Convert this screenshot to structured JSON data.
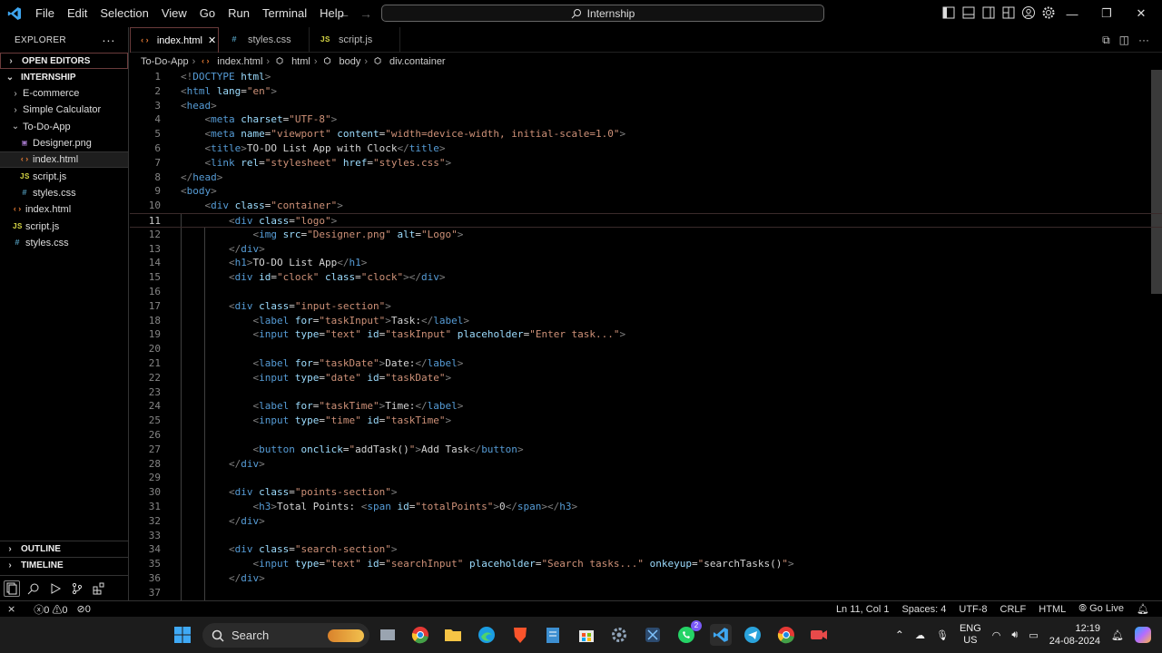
{
  "menu": [
    "File",
    "Edit",
    "Selection",
    "View",
    "Go",
    "Run",
    "Terminal",
    "Help"
  ],
  "command_center": "Internship",
  "explorer": {
    "title": "EXPLORER",
    "open_editors": "OPEN EDITORS",
    "folder": "INTERNSHIP",
    "items": [
      {
        "label": "E-commerce",
        "kind": "folder"
      },
      {
        "label": "Simple Calculator",
        "kind": "folder"
      },
      {
        "label": "To-Do-App",
        "kind": "folder-open"
      },
      {
        "label": "Designer.png",
        "kind": "png"
      },
      {
        "label": "index.html",
        "kind": "html"
      },
      {
        "label": "script.js",
        "kind": "js"
      },
      {
        "label": "styles.css",
        "kind": "css"
      },
      {
        "label": "index.html",
        "kind": "html"
      },
      {
        "label": "script.js",
        "kind": "js"
      },
      {
        "label": "styles.css",
        "kind": "css"
      }
    ],
    "outline": "OUTLINE",
    "timeline": "TIMELINE"
  },
  "tabs": [
    {
      "label": "index.html",
      "kind": "html",
      "active": true
    },
    {
      "label": "styles.css",
      "kind": "css"
    },
    {
      "label": "script.js",
      "kind": "js"
    }
  ],
  "breadcrumb": [
    "To-Do-App",
    "index.html",
    "html",
    "body",
    "div.container"
  ],
  "current_line": 11,
  "code_lines": [
    [
      [
        "g",
        "<!"
      ],
      [
        "t",
        "DOCTYPE"
      ],
      [
        "a",
        " html"
      ],
      [
        "g",
        ">"
      ]
    ],
    [
      [
        "g",
        "<"
      ],
      [
        "t",
        "html"
      ],
      [
        "a",
        " lang"
      ],
      [
        "x",
        "="
      ],
      [
        "s",
        "\"en\""
      ],
      [
        "g",
        ">"
      ]
    ],
    [
      [
        "g",
        "<"
      ],
      [
        "t",
        "head"
      ],
      [
        "g",
        ">"
      ]
    ],
    [
      [
        "x",
        "    "
      ],
      [
        "g",
        "<"
      ],
      [
        "t",
        "meta"
      ],
      [
        "a",
        " charset"
      ],
      [
        "x",
        "="
      ],
      [
        "s",
        "\"UTF-8\""
      ],
      [
        "g",
        ">"
      ]
    ],
    [
      [
        "x",
        "    "
      ],
      [
        "g",
        "<"
      ],
      [
        "t",
        "meta"
      ],
      [
        "a",
        " name"
      ],
      [
        "x",
        "="
      ],
      [
        "s",
        "\"viewport\""
      ],
      [
        "a",
        " content"
      ],
      [
        "x",
        "="
      ],
      [
        "s",
        "\"width=device-width, initial-scale=1.0\""
      ],
      [
        "g",
        ">"
      ]
    ],
    [
      [
        "x",
        "    "
      ],
      [
        "g",
        "<"
      ],
      [
        "t",
        "title"
      ],
      [
        "g",
        ">"
      ],
      [
        "x",
        "TO-DO List App with Clock"
      ],
      [
        "g",
        "</"
      ],
      [
        "t",
        "title"
      ],
      [
        "g",
        ">"
      ]
    ],
    [
      [
        "x",
        "    "
      ],
      [
        "g",
        "<"
      ],
      [
        "t",
        "link"
      ],
      [
        "a",
        " rel"
      ],
      [
        "x",
        "="
      ],
      [
        "s",
        "\"stylesheet\""
      ],
      [
        "a",
        " href"
      ],
      [
        "x",
        "="
      ],
      [
        "s",
        "\"styles.css\""
      ],
      [
        "g",
        ">"
      ]
    ],
    [
      [
        "g",
        "</"
      ],
      [
        "t",
        "head"
      ],
      [
        "g",
        ">"
      ]
    ],
    [
      [
        "g",
        "<"
      ],
      [
        "t",
        "body"
      ],
      [
        "g",
        ">"
      ]
    ],
    [
      [
        "x",
        "    "
      ],
      [
        "g",
        "<"
      ],
      [
        "t",
        "div"
      ],
      [
        "a",
        " class"
      ],
      [
        "x",
        "="
      ],
      [
        "s",
        "\"container\""
      ],
      [
        "g",
        ">"
      ]
    ],
    [
      [
        "x",
        "        "
      ],
      [
        "g",
        "<"
      ],
      [
        "t",
        "div"
      ],
      [
        "a",
        " class"
      ],
      [
        "x",
        "="
      ],
      [
        "s",
        "\"logo\""
      ],
      [
        "g",
        ">"
      ]
    ],
    [
      [
        "x",
        "            "
      ],
      [
        "g",
        "<"
      ],
      [
        "t",
        "img"
      ],
      [
        "a",
        " src"
      ],
      [
        "x",
        "="
      ],
      [
        "s",
        "\"Designer.png\""
      ],
      [
        "a",
        " alt"
      ],
      [
        "x",
        "="
      ],
      [
        "s",
        "\"Logo\""
      ],
      [
        "g",
        ">"
      ]
    ],
    [
      [
        "x",
        "        "
      ],
      [
        "g",
        "</"
      ],
      [
        "t",
        "div"
      ],
      [
        "g",
        ">"
      ]
    ],
    [
      [
        "x",
        "        "
      ],
      [
        "g",
        "<"
      ],
      [
        "t",
        "h1"
      ],
      [
        "g",
        ">"
      ],
      [
        "x",
        "TO-DO List App"
      ],
      [
        "g",
        "</"
      ],
      [
        "t",
        "h1"
      ],
      [
        "g",
        ">"
      ]
    ],
    [
      [
        "x",
        "        "
      ],
      [
        "g",
        "<"
      ],
      [
        "t",
        "div"
      ],
      [
        "a",
        " id"
      ],
      [
        "x",
        "="
      ],
      [
        "s",
        "\"clock\""
      ],
      [
        "a",
        " class"
      ],
      [
        "x",
        "="
      ],
      [
        "s",
        "\"clock\""
      ],
      [
        "g",
        "></"
      ],
      [
        "t",
        "div"
      ],
      [
        "g",
        ">"
      ]
    ],
    [],
    [
      [
        "x",
        "        "
      ],
      [
        "g",
        "<"
      ],
      [
        "t",
        "div"
      ],
      [
        "a",
        " class"
      ],
      [
        "x",
        "="
      ],
      [
        "s",
        "\"input-section\""
      ],
      [
        "g",
        ">"
      ]
    ],
    [
      [
        "x",
        "            "
      ],
      [
        "g",
        "<"
      ],
      [
        "t",
        "label"
      ],
      [
        "a",
        " for"
      ],
      [
        "x",
        "="
      ],
      [
        "s",
        "\"taskInput\""
      ],
      [
        "g",
        ">"
      ],
      [
        "x",
        "Task:"
      ],
      [
        "g",
        "</"
      ],
      [
        "t",
        "label"
      ],
      [
        "g",
        ">"
      ]
    ],
    [
      [
        "x",
        "            "
      ],
      [
        "g",
        "<"
      ],
      [
        "t",
        "input"
      ],
      [
        "a",
        " type"
      ],
      [
        "x",
        "="
      ],
      [
        "s",
        "\"text\""
      ],
      [
        "a",
        " id"
      ],
      [
        "x",
        "="
      ],
      [
        "s",
        "\"taskInput\""
      ],
      [
        "a",
        " placeholder"
      ],
      [
        "x",
        "="
      ],
      [
        "s",
        "\"Enter task...\""
      ],
      [
        "g",
        ">"
      ]
    ],
    [],
    [
      [
        "x",
        "            "
      ],
      [
        "g",
        "<"
      ],
      [
        "t",
        "label"
      ],
      [
        "a",
        " for"
      ],
      [
        "x",
        "="
      ],
      [
        "s",
        "\"taskDate\""
      ],
      [
        "g",
        ">"
      ],
      [
        "x",
        "Date:"
      ],
      [
        "g",
        "</"
      ],
      [
        "t",
        "label"
      ],
      [
        "g",
        ">"
      ]
    ],
    [
      [
        "x",
        "            "
      ],
      [
        "g",
        "<"
      ],
      [
        "t",
        "input"
      ],
      [
        "a",
        " type"
      ],
      [
        "x",
        "="
      ],
      [
        "s",
        "\"date\""
      ],
      [
        "a",
        " id"
      ],
      [
        "x",
        "="
      ],
      [
        "s",
        "\"taskDate\""
      ],
      [
        "g",
        ">"
      ]
    ],
    [],
    [
      [
        "x",
        "            "
      ],
      [
        "g",
        "<"
      ],
      [
        "t",
        "label"
      ],
      [
        "a",
        " for"
      ],
      [
        "x",
        "="
      ],
      [
        "s",
        "\"taskTime\""
      ],
      [
        "g",
        ">"
      ],
      [
        "x",
        "Time:"
      ],
      [
        "g",
        "</"
      ],
      [
        "t",
        "label"
      ],
      [
        "g",
        ">"
      ]
    ],
    [
      [
        "x",
        "            "
      ],
      [
        "g",
        "<"
      ],
      [
        "t",
        "input"
      ],
      [
        "a",
        " type"
      ],
      [
        "x",
        "="
      ],
      [
        "s",
        "\"time\""
      ],
      [
        "a",
        " id"
      ],
      [
        "x",
        "="
      ],
      [
        "s",
        "\"taskTime\""
      ],
      [
        "g",
        ">"
      ]
    ],
    [],
    [
      [
        "x",
        "            "
      ],
      [
        "g",
        "<"
      ],
      [
        "t",
        "button"
      ],
      [
        "a",
        " onclick"
      ],
      [
        "x",
        "="
      ],
      [
        "s",
        "\""
      ],
      [
        "x",
        "addTask()"
      ],
      [
        "s",
        "\""
      ],
      [
        "g",
        ">"
      ],
      [
        "x",
        "Add Task"
      ],
      [
        "g",
        "</"
      ],
      [
        "t",
        "button"
      ],
      [
        "g",
        ">"
      ]
    ],
    [
      [
        "x",
        "        "
      ],
      [
        "g",
        "</"
      ],
      [
        "t",
        "div"
      ],
      [
        "g",
        ">"
      ]
    ],
    [],
    [
      [
        "x",
        "        "
      ],
      [
        "g",
        "<"
      ],
      [
        "t",
        "div"
      ],
      [
        "a",
        " class"
      ],
      [
        "x",
        "="
      ],
      [
        "s",
        "\"points-section\""
      ],
      [
        "g",
        ">"
      ]
    ],
    [
      [
        "x",
        "            "
      ],
      [
        "g",
        "<"
      ],
      [
        "t",
        "h3"
      ],
      [
        "g",
        ">"
      ],
      [
        "x",
        "Total Points: "
      ],
      [
        "g",
        "<"
      ],
      [
        "t",
        "span"
      ],
      [
        "a",
        " id"
      ],
      [
        "x",
        "="
      ],
      [
        "s",
        "\"totalPoints\""
      ],
      [
        "g",
        ">"
      ],
      [
        "x",
        "0"
      ],
      [
        "g",
        "</"
      ],
      [
        "t",
        "span"
      ],
      [
        "g",
        "></"
      ],
      [
        "t",
        "h3"
      ],
      [
        "g",
        ">"
      ]
    ],
    [
      [
        "x",
        "        "
      ],
      [
        "g",
        "</"
      ],
      [
        "t",
        "div"
      ],
      [
        "g",
        ">"
      ]
    ],
    [],
    [
      [
        "x",
        "        "
      ],
      [
        "g",
        "<"
      ],
      [
        "t",
        "div"
      ],
      [
        "a",
        " class"
      ],
      [
        "x",
        "="
      ],
      [
        "s",
        "\"search-section\""
      ],
      [
        "g",
        ">"
      ]
    ],
    [
      [
        "x",
        "            "
      ],
      [
        "g",
        "<"
      ],
      [
        "t",
        "input"
      ],
      [
        "a",
        " type"
      ],
      [
        "x",
        "="
      ],
      [
        "s",
        "\"text\""
      ],
      [
        "a",
        " id"
      ],
      [
        "x",
        "="
      ],
      [
        "s",
        "\"searchInput\""
      ],
      [
        "a",
        " placeholder"
      ],
      [
        "x",
        "="
      ],
      [
        "s",
        "\"Search tasks...\""
      ],
      [
        "a",
        " onkeyup"
      ],
      [
        "x",
        "="
      ],
      [
        "s",
        "\""
      ],
      [
        "x",
        "searchTasks()"
      ],
      [
        "s",
        "\""
      ],
      [
        "g",
        ">"
      ]
    ],
    [
      [
        "x",
        "        "
      ],
      [
        "g",
        "</"
      ],
      [
        "t",
        "div"
      ],
      [
        "g",
        ">"
      ]
    ],
    []
  ],
  "status": {
    "errors": "0",
    "warnings": "0",
    "ports": "0",
    "position": "Ln 11, Col 1",
    "spaces": "Spaces: 4",
    "encoding": "UTF-8",
    "eol": "CRLF",
    "language": "HTML",
    "golive": "Go Live"
  },
  "taskbar": {
    "search": "Search",
    "lang1": "ENG",
    "lang2": "US",
    "time": "12:19",
    "date": "24-08-2024",
    "badge_whatsapp": "2"
  },
  "colors": {
    "accent": "#007acc",
    "html": "#e37933",
    "js": "#cbcb41",
    "css": "#519aba"
  }
}
